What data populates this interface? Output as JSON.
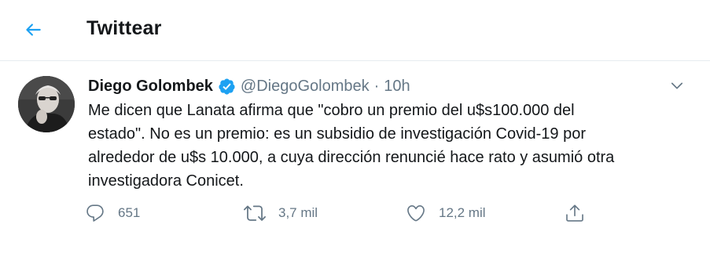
{
  "header": {
    "title": "Twittear",
    "back_icon": "arrow-left-icon",
    "accent_color": "#1da1f2"
  },
  "tweet": {
    "author_name": "Diego Golombek",
    "handle": "@DiegoGolombek",
    "separator": "·",
    "time": "10h",
    "verified": true,
    "text": "Me dicen que Lanata afirma que \"cobro un premio del u$s100.000 del\nestado\".  No es un premio: es un subsidio de investigación Covid-19 por\nalrededor de u$s 10.000, a cuya dirección renuncié  hace rato y asumió otra\ninvestigadora Conicet.",
    "actions": {
      "reply": {
        "icon": "reply-icon",
        "count": "651"
      },
      "retweet": {
        "icon": "retweet-icon",
        "count": "3,7 mil"
      },
      "like": {
        "icon": "heart-icon",
        "count": "12,2 mil"
      },
      "share": {
        "icon": "share-icon"
      }
    },
    "icon_color": "#657786"
  }
}
